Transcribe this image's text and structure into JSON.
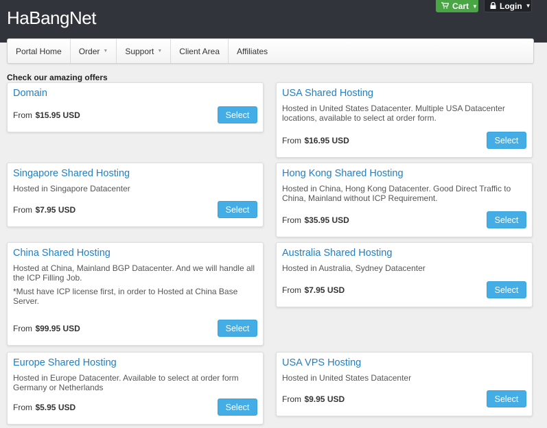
{
  "header": {
    "brand": "HaBangNet",
    "cart_label": "Cart",
    "login_label": "Login"
  },
  "nav": {
    "items": [
      {
        "label": "Portal Home"
      },
      {
        "label": "Order"
      },
      {
        "label": "Support"
      },
      {
        "label": "Client Area"
      },
      {
        "label": "Affiliates"
      }
    ]
  },
  "offers": {
    "heading": "Check our amazing offers",
    "price_prefix": "From",
    "select_label": "Select",
    "items": [
      {
        "title": "Domain",
        "desc": "",
        "note": "",
        "price": "$15.95 USD"
      },
      {
        "title": "USA Shared Hosting",
        "desc": "Hosted in United States Datacenter. Multiple USA Datacenter locations, available to select at order form.",
        "note": "",
        "price": "$16.95 USD"
      },
      {
        "title": "Singapore Shared Hosting",
        "desc": "Hosted in Singapore Datacenter",
        "note": "",
        "price": "$7.95 USD"
      },
      {
        "title": "Hong Kong Shared Hosting",
        "desc": "Hosted in China, Hong Kong Datacenter. Good Direct Traffic to China, Mainland without ICP Requirement.",
        "note": "",
        "price": "$35.95 USD"
      },
      {
        "title": "China Shared Hosting",
        "desc": "Hosted at China, Mainland BGP Datacenter. And we will handle all the ICP Filling Job.",
        "note": "*Must have ICP license first, in order to Hosted at China Base Server.",
        "price": "$99.95 USD"
      },
      {
        "title": "Australia Shared Hosting",
        "desc": "Hosted in Australia, Sydney Datacenter",
        "note": "",
        "price": "$7.95 USD"
      },
      {
        "title": "Europe Shared Hosting",
        "desc": "Hosted in Europe Datacenter. Available to select at order form Germany or Netherlands",
        "note": "",
        "price": "$5.95 USD"
      },
      {
        "title": "USA VPS Hosting",
        "desc": "Hosted in United States Datacenter",
        "note": "",
        "price": "$9.95 USD"
      }
    ]
  },
  "colors": {
    "topbar": "#31353b",
    "cart_green": "#4aa545",
    "link_blue": "#1f80c8",
    "button_blue": "#44ade6"
  }
}
